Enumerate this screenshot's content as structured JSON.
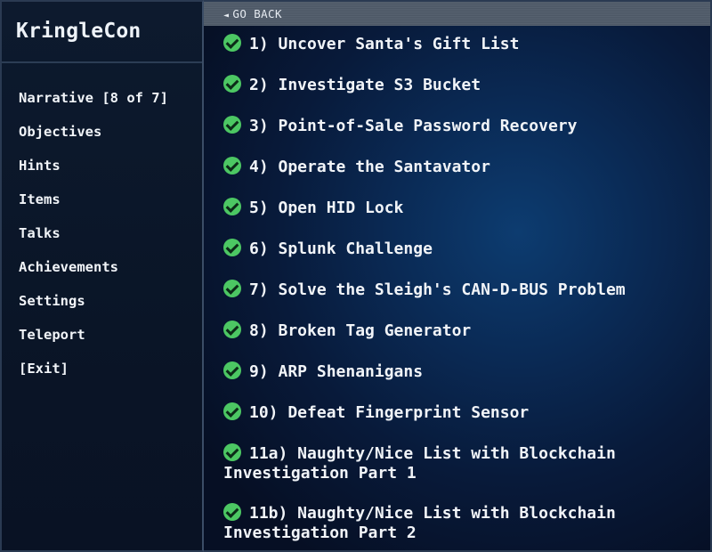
{
  "sidebar": {
    "title": "KringleCon",
    "items": [
      {
        "label": "Narrative [8 of 7]"
      },
      {
        "label": "Objectives"
      },
      {
        "label": "Hints"
      },
      {
        "label": "Items"
      },
      {
        "label": "Talks"
      },
      {
        "label": "Achievements"
      },
      {
        "label": "Settings"
      },
      {
        "label": "Teleport"
      },
      {
        "label": "[Exit]"
      }
    ]
  },
  "main": {
    "go_back_label": "GO BACK",
    "go_back_icon": "triangle-left-icon",
    "status_icon": "green-check-icon",
    "status_color": "#4cc763",
    "objectives": [
      {
        "label": "1) Uncover Santa's Gift List"
      },
      {
        "label": "2) Investigate S3 Bucket"
      },
      {
        "label": "3) Point-of-Sale Password Recovery"
      },
      {
        "label": "4) Operate the Santavator"
      },
      {
        "label": "5) Open HID Lock"
      },
      {
        "label": "6) Splunk Challenge"
      },
      {
        "label": "7) Solve the Sleigh's CAN-D-BUS Problem"
      },
      {
        "label": "8) Broken Tag Generator"
      },
      {
        "label": "9) ARP Shenanigans"
      },
      {
        "label": "10) Defeat Fingerprint Sensor"
      },
      {
        "label": "11a) Naughty/Nice List with Blockchain Investigation Part 1"
      },
      {
        "label": "11b) Naughty/Nice List with Blockchain Investigation Part 2"
      }
    ]
  }
}
